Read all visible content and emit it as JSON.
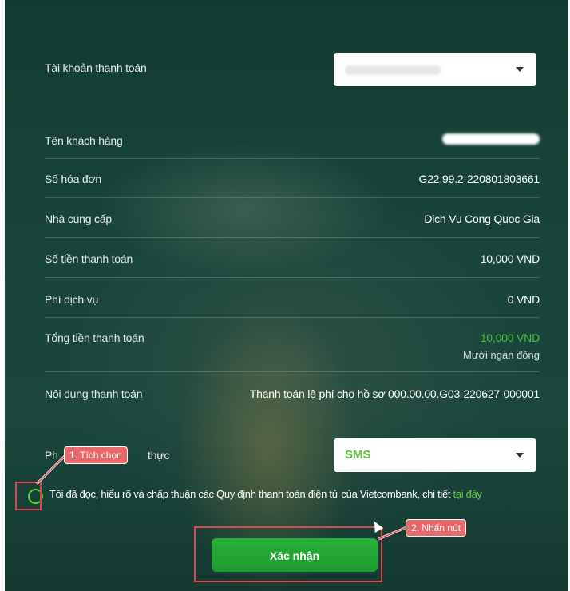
{
  "form": {
    "account_label": "Tài khoản thanh toán",
    "customer_label": "Tên khách hàng",
    "invoice_label": "Số hóa đơn",
    "invoice_value": "G22.99.2-220801803661",
    "provider_label": "Nhà cung cấp",
    "provider_value": "Dich Vu Cong Quoc Gia",
    "amount_label": "Số tiền thanh toán",
    "amount_value": "10,000 VND",
    "fee_label": "Phí dịch vụ",
    "fee_value": "0 VND",
    "total_label": "Tổng tiền thanh toán",
    "total_value": "10,000 VND",
    "total_words": "Mười ngàn đồng",
    "content_label": "Nội dung thanh toán",
    "content_value": "Thanh toán lệ phí cho hồ sơ 000.00.00.G03-220627-000001",
    "auth_label_start": "Ph",
    "auth_label_end": "thực",
    "auth_value": "SMS",
    "agree_text": "Tôi đã đọc, hiểu rõ và chấp thuận các Quy định thanh toán điện tử của Vietcombank, chi tiết ",
    "agree_link": "tại đây",
    "confirm_label": "Xác nhận"
  },
  "annotations": {
    "step1": "1. Tích chọn",
    "step2": "2. Nhấn nút"
  },
  "colors": {
    "accent_green": "#47c135",
    "annotation_red": "#e0474c"
  },
  "icons": {
    "dropdown": "chevron-down-icon",
    "radio": "radio-unchecked-icon",
    "cursor": "mouse-pointer-icon"
  }
}
